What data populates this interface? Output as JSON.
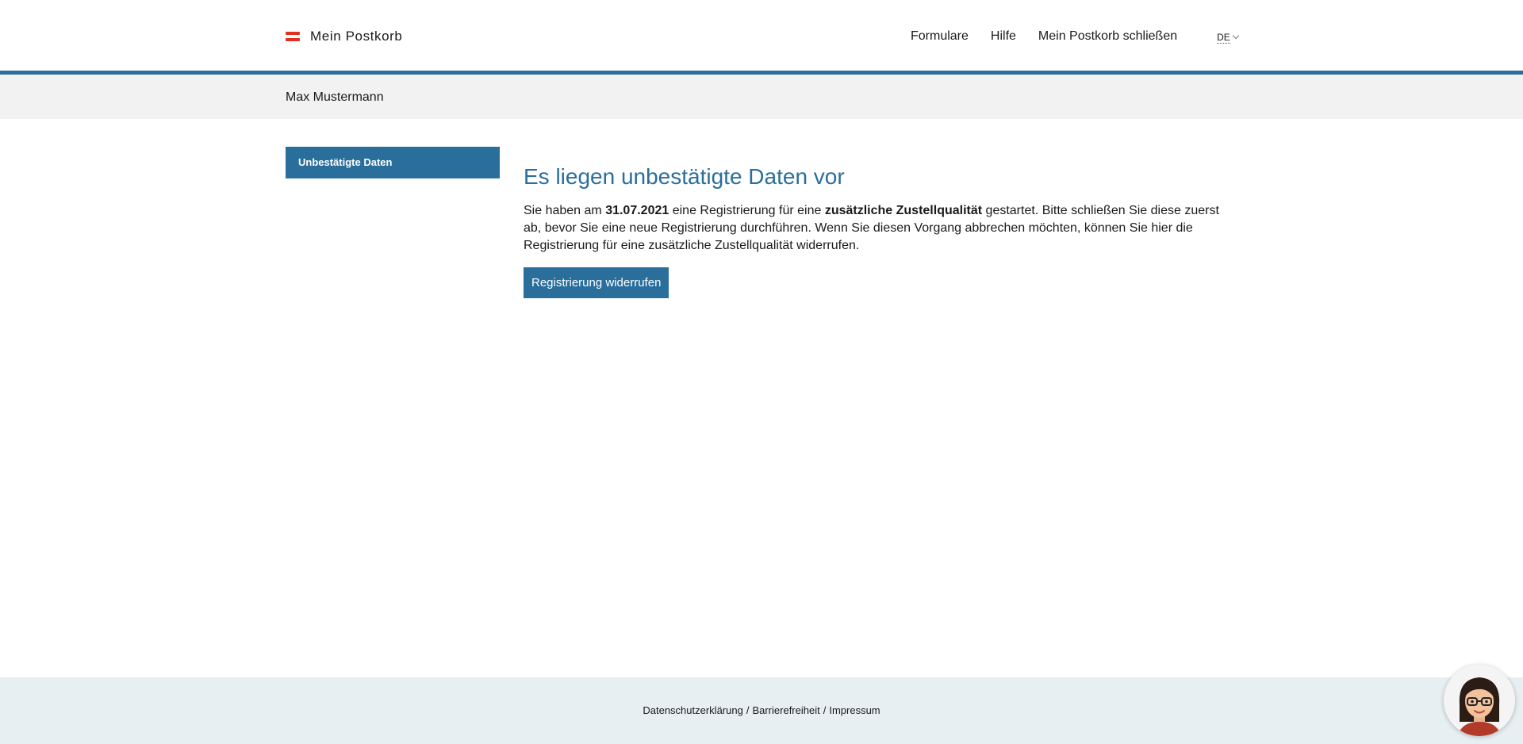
{
  "header": {
    "logo_text": "Mein Postkorb",
    "nav": {
      "formulare": "Formulare",
      "hilfe": "Hilfe",
      "close": "Mein Postkorb schließen"
    },
    "language": "DE"
  },
  "userbar": {
    "name": "Max Mustermann"
  },
  "sidebar": {
    "items": [
      {
        "label": "Unbestätigte Daten",
        "active": true
      }
    ]
  },
  "main": {
    "title": "Es liegen unbestätigte Daten vor",
    "text_1": "Sie haben am ",
    "date": "31.07.2021",
    "text_2": " eine Registrierung für eine ",
    "quality": "zusätzliche Zustellqualität",
    "text_3": " gestartet. Bitte schließen Sie diese zuerst ab, bevor Sie eine neue Registrierung durchführen. Wenn Sie diesen Vorgang abbrechen möchten, können Sie hier die Registrierung für eine zusätzliche Zustellqualität widerrufen.",
    "button_label": "Registrierung widerrufen"
  },
  "footer": {
    "privacy": "Datenschutzerklärung",
    "accessibility": "Barrierefreiheit",
    "imprint": "Impressum",
    "separator": "/"
  },
  "colors": {
    "accent": "#2a6e9c",
    "flag_red": "#e3311d",
    "userbar_bg": "#f2f2f2",
    "footer_bg": "#e7eff3"
  },
  "icons": {
    "logo": "austrian-flag-icon",
    "language_dropdown": "chevron-down-icon",
    "chatbot": "chatbot-avatar-icon"
  }
}
